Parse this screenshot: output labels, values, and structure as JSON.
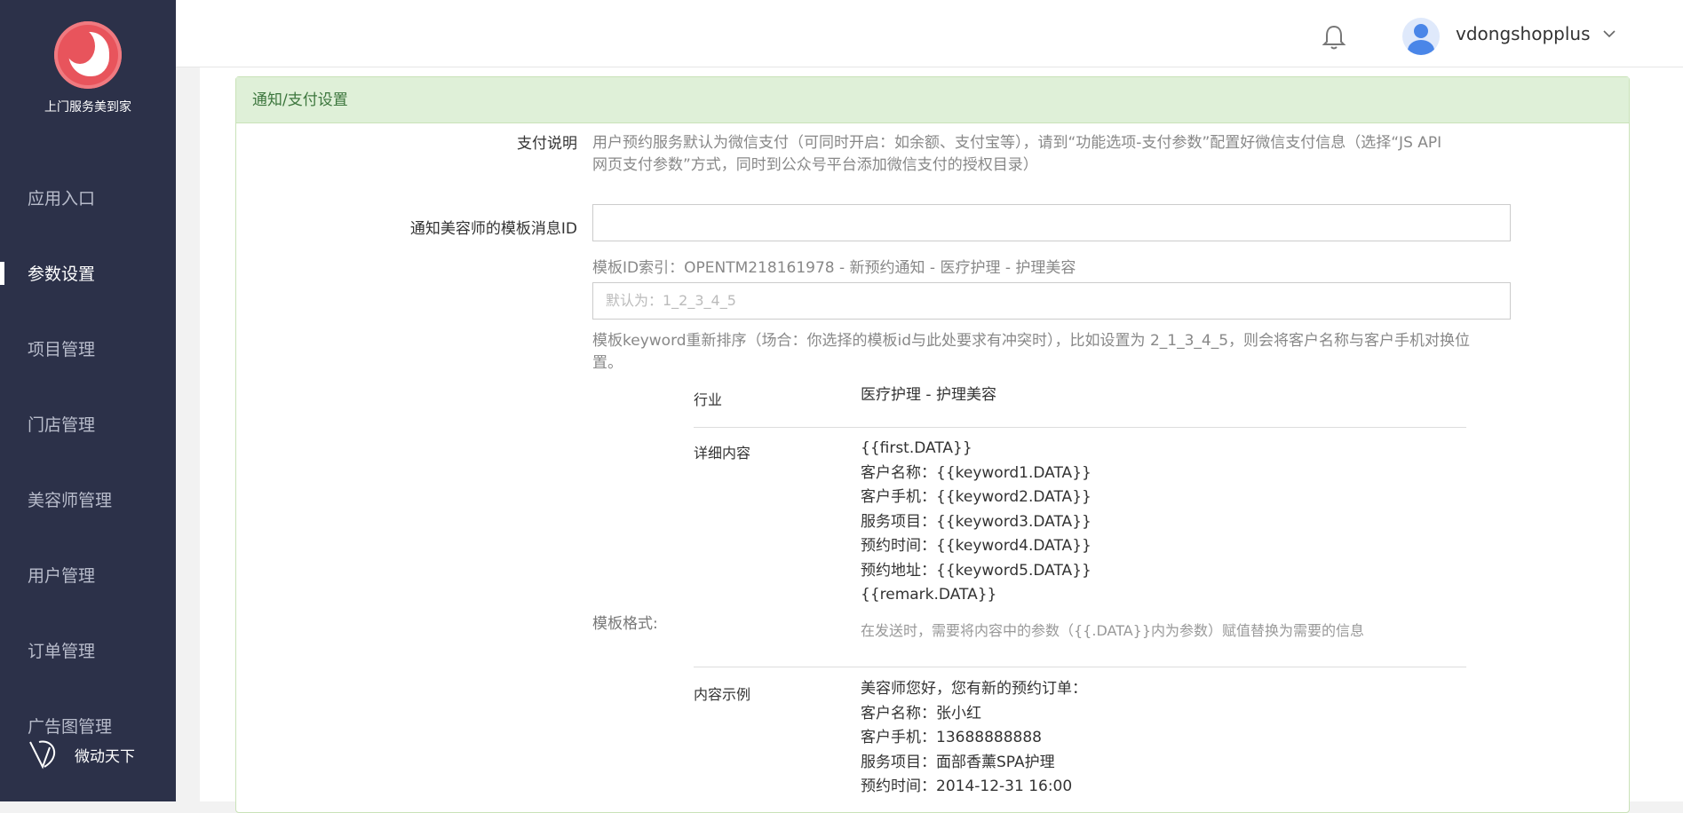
{
  "app": {
    "logo_text": "上门服务美到家",
    "brand": "微动天下"
  },
  "nav": {
    "items": [
      {
        "label": "应用入口",
        "active": false
      },
      {
        "label": "参数设置",
        "active": true
      },
      {
        "label": "项目管理",
        "active": false
      },
      {
        "label": "门店管理",
        "active": false
      },
      {
        "label": "美容师管理",
        "active": false
      },
      {
        "label": "用户管理",
        "active": false
      },
      {
        "label": "订单管理",
        "active": false
      },
      {
        "label": "广告图管理",
        "active": false
      }
    ]
  },
  "topbar": {
    "username": "vdongshopplus"
  },
  "section": {
    "title": "通知/支付设置",
    "pay_label": "支付说明",
    "pay_help_line1": "用户预约服务默认为微信支付（可同时开启：如余额、支付宝等），请到“功能选项-支付参数”配置好微信支付信息（选择“JS API",
    "pay_help_line2": "网页支付参数”方式，同时到公众号平台添加微信支付的授权目录）",
    "tpl_id_label": "通知美容师的模板消息ID",
    "tpl_id_value": "",
    "tpl_index": "模板ID索引：OPENTM218161978 - 新预约通知 - 医疗护理 - 护理美容",
    "order_placeholder": "默认为：1_2_3_4_5",
    "order_help_line1": "模板keyword重新排序（场合：你选择的模板id与此处要求有冲突时），比如设置为 2_1_3_4_5，则会将客户名称与客户手机对换位",
    "order_help_line2": "置。",
    "tpl_format_label": "模板格式:",
    "industry_key": "行业",
    "industry_val": "医疗护理 - 护理美容",
    "detail_key": "详细内容",
    "detail_lines": [
      "{{first.DATA}}",
      "客户名称：{{keyword1.DATA}}",
      "客户手机：{{keyword2.DATA}}",
      "服务项目：{{keyword3.DATA}}",
      "预约时间：{{keyword4.DATA}}",
      "预约地址：{{keyword5.DATA}}",
      "{{remark.DATA}}"
    ],
    "detail_note": "在发送时，需要将内容中的参数（{{.DATA}}内为参数）赋值替换为需要的信息",
    "example_key": "内容示例",
    "example_lines": [
      "美容师您好，您有新的预约订单：",
      "客户名称：张小红",
      "客户手机：13688888888",
      "服务项目：面部香薰SPA护理",
      "预约时间：2014-12-31 16:00"
    ]
  }
}
